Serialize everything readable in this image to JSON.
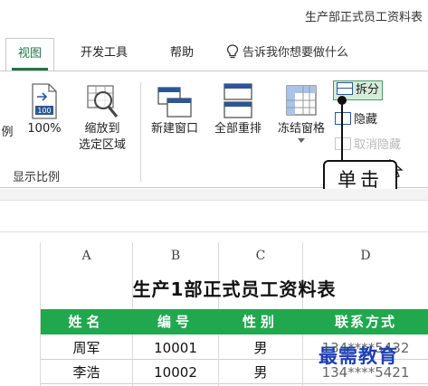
{
  "window": {
    "title": "生产部正式员工资料表"
  },
  "tabs": [
    {
      "label": "视图",
      "active": true
    },
    {
      "label": "开发工具",
      "active": false
    },
    {
      "label": "帮助",
      "active": false
    }
  ],
  "tell_me": {
    "label": "告诉我你想要做什么"
  },
  "ribbon": {
    "zoom_label_partial": "例",
    "zoom_100": "100%",
    "zoom_selection": "缩放到\n选定区域",
    "zoom_selection_line1": "缩放到",
    "zoom_selection_line2": "选定区域",
    "group_zoom": "显示比例",
    "new_window": "新建窗口",
    "arrange_all": "全部重排",
    "freeze_panes": "冻结窗格",
    "split": "拆分",
    "hide": "隐藏",
    "unhide": "取消隐藏"
  },
  "callout": {
    "label": "单击"
  },
  "sheet": {
    "columns": [
      "A",
      "B",
      "C",
      "D"
    ],
    "title": "生产1部正式员工资料表",
    "headers": [
      "姓名",
      "编号",
      "性别",
      "联系方式"
    ],
    "rows": [
      {
        "name": "周军",
        "id": "10001",
        "gender": "男",
        "phone": "134****5432"
      },
      {
        "name": "李浩",
        "id": "10002",
        "gender": "男",
        "phone": "134****5421"
      }
    ]
  },
  "watermark": "最需教育",
  "colors": {
    "accent": "#217346",
    "header_green": "#21a84f",
    "watermark": "#1e3fb4"
  }
}
